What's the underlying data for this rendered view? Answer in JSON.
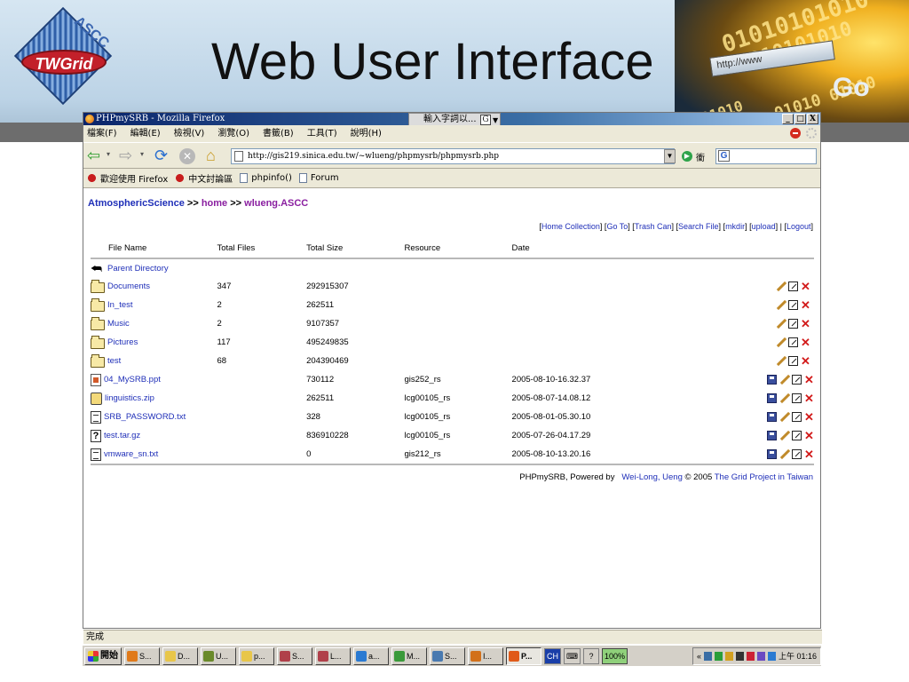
{
  "slide": {
    "title": "Web User Interface",
    "logo_text": "TWGrid",
    "logo_arc_text": "ASCC",
    "banner_url_text": "http://www",
    "banner_go_text": "Go",
    "banner_digits": [
      "01010101010",
      "1010101010",
      "01010 01010",
      "101010"
    ]
  },
  "browser": {
    "window_title": "PHPmySRB - Mozilla Firefox",
    "ime_text": "輸入字詞以...",
    "ime_g": "G",
    "window_buttons": [
      "_",
      "□",
      "X"
    ],
    "menu": [
      "檔案(F)",
      "編輯(E)",
      "檢視(V)",
      "瀏覽(O)",
      "書籤(B)",
      "工具(T)",
      "說明(H)"
    ],
    "url": "http://gis219.sinica.edu.tw/~wlueng/phpmysrb/phpmysrb.php",
    "go_label": "衝",
    "search_g": "G",
    "bookmarks": [
      "歡迎使用 Firefox",
      "中文討論區",
      "phpinfo()",
      "Forum"
    ],
    "status_text": "完成"
  },
  "page": {
    "breadcrumb": {
      "root": "AtmosphericScience",
      "sep1": ">>",
      "home": "home",
      "sep2": ">>",
      "current": "wlueng.ASCC"
    },
    "actions": [
      "Home Collection",
      "Go To",
      "Trash Can",
      "Search File",
      "mkdir",
      "upload",
      "Logout"
    ],
    "columns": [
      "File Name",
      "Total Files",
      "Total Size",
      "Resource",
      "Date"
    ],
    "parent_label": "Parent Directory",
    "rows": [
      {
        "name": "Documents",
        "files": "347",
        "size": "292915307",
        "resource": "",
        "date": "",
        "type": "folder"
      },
      {
        "name": "In_test",
        "files": "2",
        "size": "262511",
        "resource": "",
        "date": "",
        "type": "folder"
      },
      {
        "name": "Music",
        "files": "2",
        "size": "9107357",
        "resource": "",
        "date": "",
        "type": "folder"
      },
      {
        "name": "Pictures",
        "files": "117",
        "size": "495249835",
        "resource": "",
        "date": "",
        "type": "folder"
      },
      {
        "name": "test",
        "files": "68",
        "size": "204390469",
        "resource": "",
        "date": "",
        "type": "folder"
      },
      {
        "name": "04_MySRB.ppt",
        "files": "",
        "size": "730112",
        "resource": "gis252_rs",
        "date": "2005-08-10-16.32.37",
        "type": "ppt"
      },
      {
        "name": "linguistics.zip",
        "files": "",
        "size": "262511",
        "resource": "lcg00105_rs",
        "date": "2005-08-07-14.08.12",
        "type": "zip"
      },
      {
        "name": "SRB_PASSWORD.txt",
        "files": "",
        "size": "328",
        "resource": "lcg00105_rs",
        "date": "2005-08-01-05.30.10",
        "type": "txt"
      },
      {
        "name": "test.tar.gz",
        "files": "",
        "size": "836910228",
        "resource": "lcg00105_rs",
        "date": "2005-07-26-04.17.29",
        "type": "unknown"
      },
      {
        "name": "vmware_sn.txt",
        "files": "",
        "size": "0",
        "resource": "gis212_rs",
        "date": "2005-08-10-13.20.16",
        "type": "txt"
      }
    ],
    "footer": {
      "prefix": "PHPmySRB, Powered by",
      "author": "Wei-Long, Ueng",
      "copyright": "© 2005",
      "project": "The Grid Project in Taiwan"
    }
  },
  "taskbar": {
    "start_label": "開始",
    "tasks": [
      "S...",
      "D...",
      "U...",
      "p...",
      "S...",
      "L...",
      "a...",
      "M...",
      "S...",
      "I...",
      "P..."
    ],
    "ch_label": "CH",
    "zoom_label": "100%",
    "tray_chevron": "«",
    "clock": "上午 01:16"
  }
}
